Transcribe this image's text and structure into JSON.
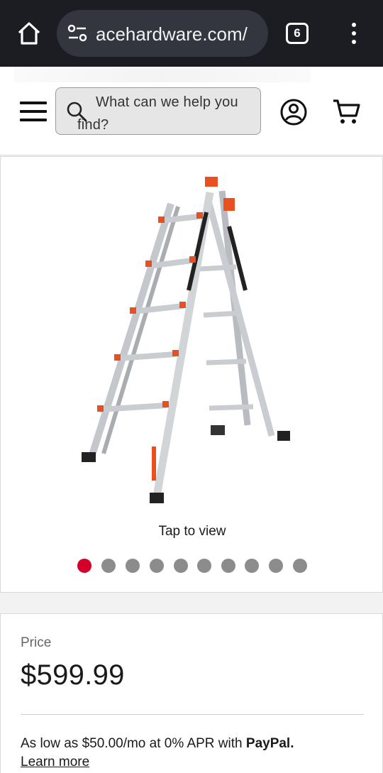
{
  "browser": {
    "url": "acehardware.com/",
    "tab_count": "6"
  },
  "header": {
    "search_placeholder": "What can we help you find?"
  },
  "gallery": {
    "tap_to_view": "Tap to view",
    "dot_count": 10,
    "active_index": 0,
    "accent_color": "#d40029"
  },
  "pricing": {
    "price_label": "Price",
    "price": "$599.99",
    "financing_prefix": "As low as $50.00/mo at 0% APR with",
    "financing_brand": "PayPal.",
    "learn_more": "Learn more"
  },
  "icons": [
    "home-icon",
    "tune-icon",
    "menu-icon",
    "hamburger-icon",
    "search-icon",
    "account-icon",
    "cart-icon"
  ]
}
